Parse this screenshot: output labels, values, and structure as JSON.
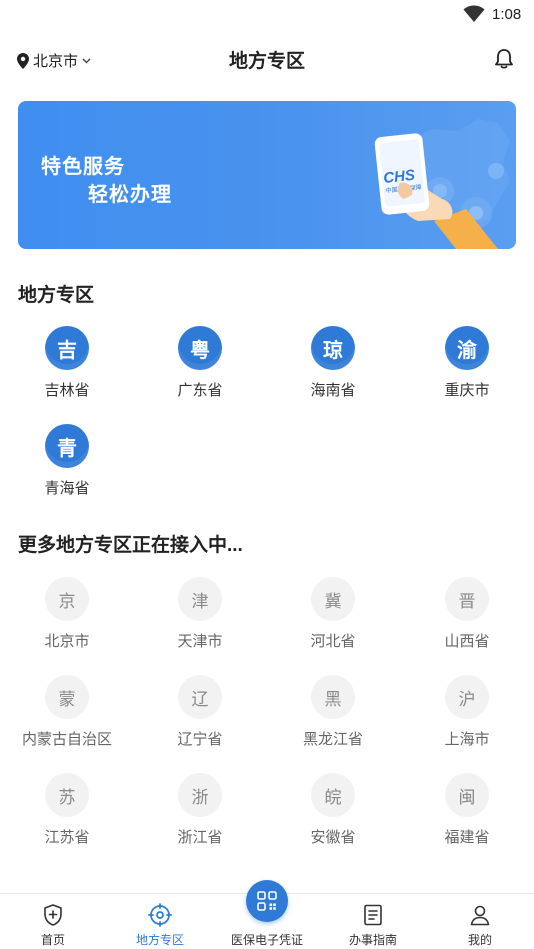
{
  "status": {
    "time": "1:08"
  },
  "header": {
    "location": "北京市",
    "title": "地方专区"
  },
  "banner": {
    "line1": "特色服务",
    "line2": "轻松办理",
    "brand": "CHS",
    "brand_sub": "中国医疗保障"
  },
  "active_section": {
    "title": "地方专区",
    "items": [
      {
        "label": "吉林省",
        "glyph": "吉"
      },
      {
        "label": "广东省",
        "glyph": "粤"
      },
      {
        "label": "海南省",
        "glyph": "琼"
      },
      {
        "label": "重庆市",
        "glyph": "渝"
      },
      {
        "label": "青海省",
        "glyph": "青"
      }
    ]
  },
  "coming_section": {
    "title": "更多地方专区正在接入中...",
    "items": [
      {
        "label": "北京市",
        "glyph": "京"
      },
      {
        "label": "天津市",
        "glyph": "津"
      },
      {
        "label": "河北省",
        "glyph": "冀"
      },
      {
        "label": "山西省",
        "glyph": "晋"
      },
      {
        "label": "内蒙古自治区",
        "glyph": "蒙"
      },
      {
        "label": "辽宁省",
        "glyph": "辽"
      },
      {
        "label": "黑龙江省",
        "glyph": "黑"
      },
      {
        "label": "上海市",
        "glyph": "沪"
      },
      {
        "label": "江苏省",
        "glyph": "苏"
      },
      {
        "label": "浙江省",
        "glyph": "浙"
      },
      {
        "label": "安徽省",
        "glyph": "皖"
      },
      {
        "label": "福建省",
        "glyph": "闽"
      }
    ]
  },
  "tabs": [
    {
      "label": "首页",
      "icon": "shield-plus-icon"
    },
    {
      "label": "地方专区",
      "icon": "location-target-icon",
      "active": true
    },
    {
      "label": "医保电子凭证",
      "icon": "qr-code-icon"
    },
    {
      "label": "办事指南",
      "icon": "document-icon"
    },
    {
      "label": "我的",
      "icon": "user-icon"
    }
  ],
  "colors": {
    "primary": "#2e7ad6",
    "banner": "#4a93ee",
    "inactive_circle": "#f2f2f2"
  }
}
